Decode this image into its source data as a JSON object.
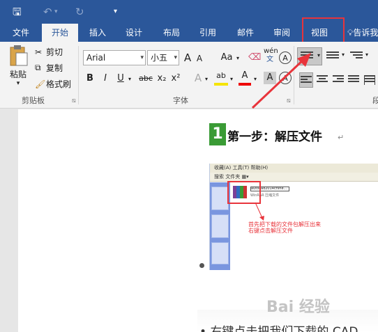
{
  "colors": {
    "brand": "#2b579a",
    "highlight": "#e8343b",
    "step": "#3a9b35"
  },
  "qat": {
    "save_icon": "save-icon",
    "undo_icon": "undo-icon",
    "redo_icon": "redo-icon",
    "customize_icon": "customize-icon",
    "save": "🖫",
    "undo": "↶",
    "redo": "↻",
    "customize": "▾"
  },
  "tabs": [
    {
      "label": "文件"
    },
    {
      "label": "开始"
    },
    {
      "label": "插入"
    },
    {
      "label": "设计"
    },
    {
      "label": "布局"
    },
    {
      "label": "引用"
    },
    {
      "label": "邮件"
    },
    {
      "label": "审阅"
    },
    {
      "label": "视图"
    }
  ],
  "tell_me": "告诉我",
  "clipboard": {
    "paste": "粘贴",
    "cut": "剪切",
    "copy": "复制",
    "format_painter": "格式刷",
    "group": "剪贴板"
  },
  "font": {
    "name": "Arial",
    "size": "小五",
    "group": "字体",
    "grow": "A",
    "shrink": "A",
    "case": "Aa",
    "phonetic_top": "wén",
    "phonetic_bottom": "文",
    "bold": "B",
    "italic": "I",
    "underline": "U",
    "strike": "abc",
    "sub": "x₂",
    "sup": "x²",
    "effects": "A",
    "highlight": "ab",
    "color": "A",
    "enclose": "A",
    "border_char": "A"
  },
  "paragraph": {
    "group_initial": "段"
  },
  "document": {
    "step_number": "1",
    "step_title": "第一步：解压文件",
    "para_mark": "↵",
    "shot_menu": "收藏(A)   工具(T)   帮助(H)",
    "shot_toolbar": "搜索   文件夹   ▦▾",
    "shot_file": "autocad2014chine...",
    "shot_file_sub": "WinRAR 压缩文件",
    "shot_note_line1": "首先把下载的文件包解压出来",
    "shot_note_line2": "右键点击解压文件",
    "watermark": "Bai 经验",
    "bottom_text": "右键点击把我们下载的 CAD"
  }
}
